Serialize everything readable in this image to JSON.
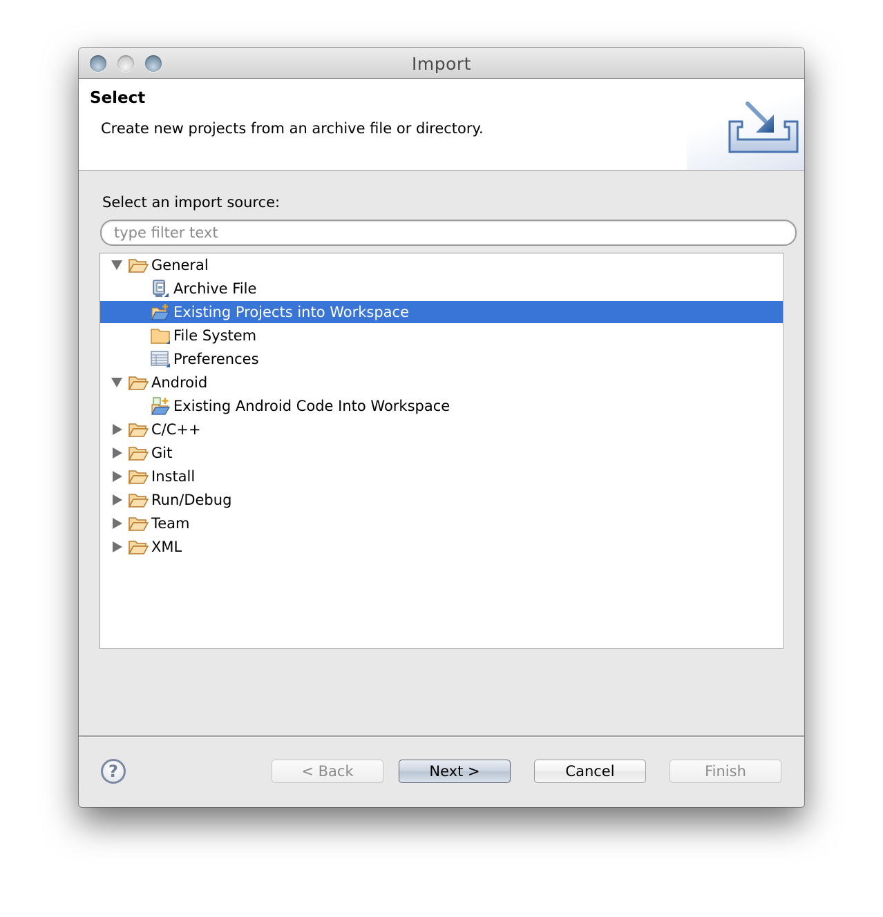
{
  "window": {
    "title": "Import",
    "controls": [
      "close",
      "minimize",
      "zoom"
    ]
  },
  "banner": {
    "title": "Select",
    "description": "Create new projects from an archive file or directory.",
    "icon": "import-wizard-icon"
  },
  "source": {
    "label": "Select an import source:",
    "filter_placeholder": "type filter text",
    "filter_value": ""
  },
  "tree": {
    "selected": "Existing Projects into Workspace",
    "rows": [
      {
        "label": "General",
        "level": 0,
        "expanded": true,
        "icon": "folder-open-icon"
      },
      {
        "label": "Archive File",
        "level": 1,
        "icon": "archive-file-icon"
      },
      {
        "label": "Existing Projects into Workspace",
        "level": 1,
        "icon": "existing-projects-icon",
        "selected": true
      },
      {
        "label": "File System",
        "level": 1,
        "icon": "file-system-folder-icon"
      },
      {
        "label": "Preferences",
        "level": 1,
        "icon": "preferences-icon"
      },
      {
        "label": "Android",
        "level": 0,
        "expanded": true,
        "icon": "folder-open-icon"
      },
      {
        "label": "Existing Android Code Into Workspace",
        "level": 1,
        "icon": "android-code-icon"
      },
      {
        "label": "C/C++",
        "level": 0,
        "expanded": false,
        "icon": "folder-open-icon"
      },
      {
        "label": "Git",
        "level": 0,
        "expanded": false,
        "icon": "folder-open-icon"
      },
      {
        "label": "Install",
        "level": 0,
        "expanded": false,
        "icon": "folder-open-icon"
      },
      {
        "label": "Run/Debug",
        "level": 0,
        "expanded": false,
        "icon": "folder-open-icon"
      },
      {
        "label": "Team",
        "level": 0,
        "expanded": false,
        "icon": "folder-open-icon"
      },
      {
        "label": "XML",
        "level": 0,
        "expanded": false,
        "icon": "folder-open-icon"
      }
    ]
  },
  "footer": {
    "help_glyph": "?",
    "buttons": {
      "back": {
        "label": "< Back",
        "enabled": false
      },
      "next": {
        "label": "Next >",
        "enabled": true,
        "default": true
      },
      "cancel": {
        "label": "Cancel",
        "enabled": true
      },
      "finish": {
        "label": "Finish",
        "enabled": false
      }
    }
  },
  "colors": {
    "selection": "#3875d7",
    "folder": "#f0c77a"
  }
}
